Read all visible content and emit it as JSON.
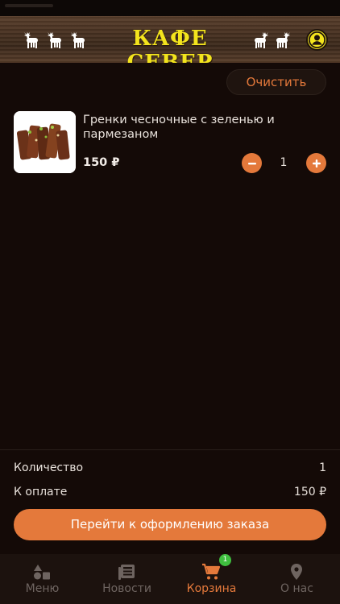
{
  "header": {
    "title": "КАФЕ СЕВЕР",
    "brand_color": "#f3e41d",
    "deer_icon": "reindeer-icon",
    "profile_icon": "user-circle-icon"
  },
  "cart": {
    "clear_label": "Очистить",
    "items": [
      {
        "name": "Гренки чесночные с зеленью и пармезаном",
        "price": "150 ₽",
        "quantity": "1",
        "image": "garlic-croutons-photo"
      }
    ]
  },
  "summary": {
    "quantity_label": "Количество",
    "quantity_value": "1",
    "total_label": "К оплате",
    "total_value": "150 ₽",
    "checkout_label": "Перейти к оформлению заказа"
  },
  "tabbar": {
    "tabs": [
      {
        "label": "Меню",
        "icon": "shapes-icon",
        "active": false
      },
      {
        "label": "Новости",
        "icon": "newspaper-icon",
        "active": false
      },
      {
        "label": "Корзина",
        "icon": "cart-icon",
        "active": true,
        "badge": "1"
      },
      {
        "label": "О нас",
        "icon": "location-pin-icon",
        "active": false
      }
    ]
  },
  "colors": {
    "accent": "#e4793b",
    "background": "#140a07",
    "badge": "#3fbf3f"
  }
}
